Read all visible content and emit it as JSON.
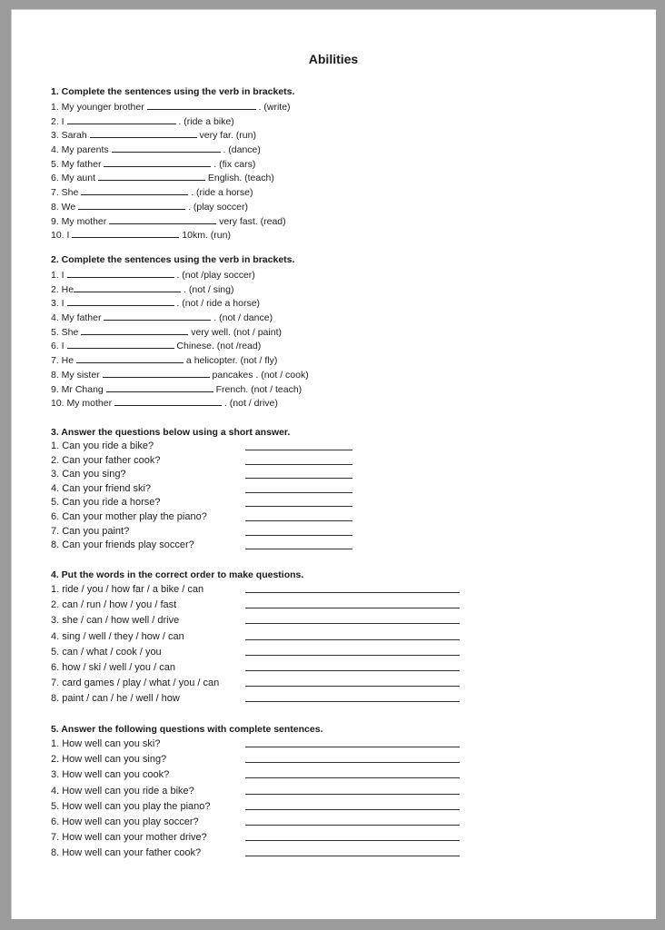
{
  "title": "Abilities",
  "sections": [
    {
      "heading": "1. Complete the sentences using the verb in brackets.",
      "items": [
        {
          "pre": "1. My younger brother ",
          "post": " . (write)"
        },
        {
          "pre": "2. I ",
          "post": " . (ride a bike)"
        },
        {
          "pre": "3. Sarah ",
          "post": " very far.  (run)"
        },
        {
          "pre": "4. My parents ",
          "post": " . (dance)"
        },
        {
          "pre": "5. My father ",
          "post": " . (fix cars)"
        },
        {
          "pre": "6. My aunt ",
          "post": " English.  (teach)"
        },
        {
          "pre": "7. She ",
          "post": " .  (ride a horse)"
        },
        {
          "pre": "8. We ",
          "post": " .  (play soccer)"
        },
        {
          "pre": "9. My mother ",
          "post": " very fast. (read)"
        },
        {
          "pre": "10. I ",
          "post": " 10km. (run)"
        }
      ]
    },
    {
      "heading": "2. Complete the sentences using the verb in brackets.",
      "items": [
        {
          "pre": "1. I ",
          "post": " . (not /play soccer)"
        },
        {
          "pre": "2. He",
          "post": " . (not / sing)"
        },
        {
          "pre": "3. I ",
          "post": " .  (not / ride a horse)"
        },
        {
          "pre": "4. My father ",
          "post": " . (not / dance)"
        },
        {
          "pre": "5. She ",
          "post": " very well. (not / paint)"
        },
        {
          "pre": "6. I ",
          "post": " Chinese.  (not /read)"
        },
        {
          "pre": "7. He ",
          "post": " a helicopter.  (not / fly)"
        },
        {
          "pre": "8. My sister ",
          "post": " pancakes .  (not / cook)"
        },
        {
          "pre": "9. Mr Chang ",
          "post": " French. (not / teach)"
        },
        {
          "pre": "10. My mother ",
          "post": " . (not / drive)"
        }
      ]
    },
    {
      "heading": "3. Answer the questions below using a short answer.",
      "items": [
        "1. Can you ride a bike?",
        "2. Can your father cook?",
        "3. Can you sing?",
        "4. Can your friend ski?",
        "5. Can you ride a horse?",
        "6. Can your mother play the piano?",
        "7. Can you paint?",
        "8. Can your friends play soccer?"
      ]
    },
    {
      "heading": "4. Put the words in the correct order to make questions.",
      "items": [
        "1. ride / you / how far / a bike / can",
        "2. can / run / how / you / fast",
        "3. she / can / how well / drive",
        "4. sing / well / they / how / can",
        "5.  can / what / cook / you",
        "6. how / ski / well / you / can",
        "7. card games / play / what / you / can",
        "8. paint / can / he / well / how"
      ]
    },
    {
      "heading": "5. Answer the following questions with complete sentences.",
      "items": [
        "1. How well can you ski?",
        "2. How well can you sing?",
        "3. How well can you cook?",
        "4. How well can you ride a bike?",
        "5. How well can you play the piano?",
        "6. How well can you play soccer?",
        "7. How well can your mother drive?",
        "8. How well can your father cook?"
      ]
    }
  ]
}
